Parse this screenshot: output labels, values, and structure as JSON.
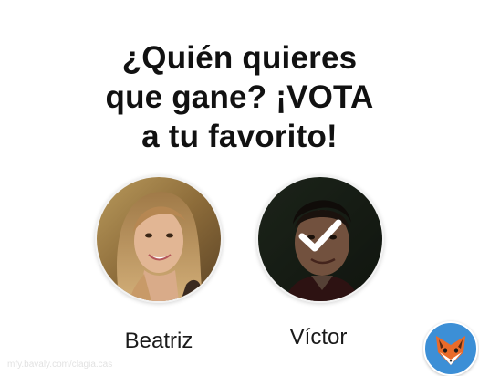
{
  "title": {
    "line1": "¿Quién quieres",
    "line2": "que gane? ¡VOTA",
    "line3": "a tu favorito!"
  },
  "candidates": [
    {
      "name": "Beatriz",
      "selected": false
    },
    {
      "name": "Víctor",
      "selected": true
    }
  ],
  "watermark": "mfy.bavaly.com/clagia.cas",
  "icons": {
    "check": "check-icon",
    "logo": "fox-logo-icon"
  },
  "colors": {
    "text": "#111111",
    "logo_bg": "#3c8fd6",
    "logo_fox": "#e86b2a"
  }
}
